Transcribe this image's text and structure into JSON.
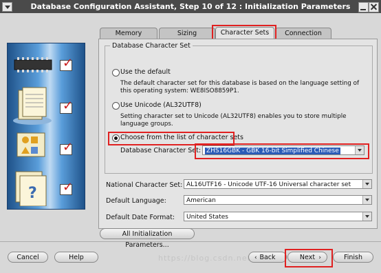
{
  "window": {
    "title": "Database Configuration Assistant, Step 10 of 12 : Initialization Parameters"
  },
  "tabs": [
    {
      "label": "Memory"
    },
    {
      "label": "Sizing"
    },
    {
      "label": "Character Sets"
    },
    {
      "label": "Connection Mode"
    }
  ],
  "charset_group": {
    "title": "Database Character Set",
    "options": [
      {
        "label": "Use the default",
        "selected": false,
        "description": "The default character set for this database is based on the language setting of this operating system: WE8ISO8859P1."
      },
      {
        "label": "Use Unicode (AL32UTF8)",
        "selected": false,
        "description": "Setting character set to Unicode (AL32UTF8) enables you to store multiple language groups."
      },
      {
        "label": "Choose from the list of character sets",
        "selected": true
      }
    ],
    "db_charset_label": "Database Character Set:",
    "db_charset_value": "ZHS16GBK - GBK 16-bit Simplified Chinese"
  },
  "fields": {
    "national_label": "National Character Set:",
    "national_value": "AL16UTF16 - Unicode UTF-16 Universal character set",
    "language_label": "Default Language:",
    "language_value": "American",
    "date_label": "Default Date Format:",
    "date_value": "United States"
  },
  "buttons": {
    "all_params": "All Initialization Parameters...",
    "cancel": "Cancel",
    "help": "Help",
    "back": "Back",
    "next": "Next",
    "finish": "Finish"
  },
  "watermark": "https://blog.csdn.net/..."
}
